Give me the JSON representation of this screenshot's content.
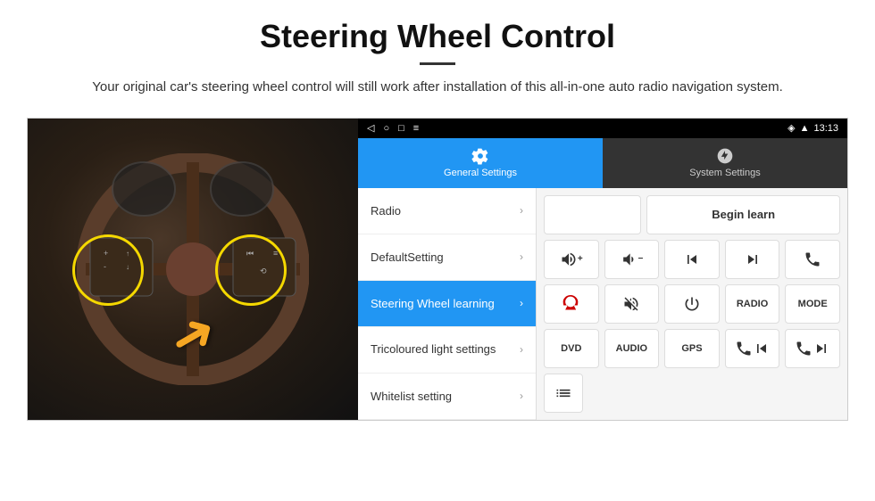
{
  "header": {
    "title": "Steering Wheel Control",
    "subtitle": "Your original car's steering wheel control will still work after installation of this all-in-one auto radio navigation system."
  },
  "status_bar": {
    "time": "13:13",
    "left_icons": [
      "back-icon",
      "home-icon",
      "square-icon",
      "menu-icon"
    ]
  },
  "tabs": [
    {
      "id": "general",
      "label": "General Settings",
      "active": true
    },
    {
      "id": "system",
      "label": "System Settings",
      "active": false
    }
  ],
  "menu_items": [
    {
      "id": "radio",
      "label": "Radio",
      "active": false
    },
    {
      "id": "defaultsetting",
      "label": "DefaultSetting",
      "active": false
    },
    {
      "id": "steeringwheel",
      "label": "Steering Wheel learning",
      "active": true
    },
    {
      "id": "tricoloured",
      "label": "Tricoloured light settings",
      "active": false
    },
    {
      "id": "whitelist",
      "label": "Whitelist setting",
      "active": false
    }
  ],
  "controls": {
    "begin_learn_label": "Begin learn",
    "buttons": {
      "row1": [
        "vol+",
        "vol-",
        "prev",
        "next",
        "phone"
      ],
      "row2": [
        "hangup",
        "mute",
        "power",
        "radio",
        "mode"
      ],
      "row3": [
        "dvd",
        "audio",
        "gps",
        "vol_prev",
        "vol_next"
      ],
      "row4": [
        "list"
      ]
    }
  }
}
